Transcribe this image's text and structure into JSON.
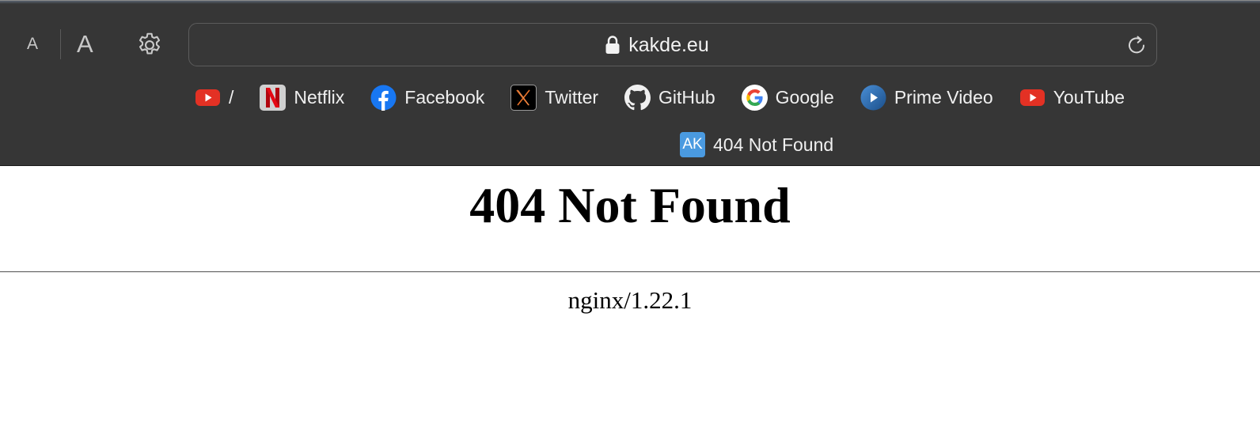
{
  "toolbar": {
    "text_smaller_label": "A",
    "text_larger_label": "A",
    "address": {
      "url": "kakde.eu"
    }
  },
  "favorites": [
    {
      "label": "/",
      "icon": "youtube-icon"
    },
    {
      "label": "Netflix",
      "icon": "netflix-icon"
    },
    {
      "label": "Facebook",
      "icon": "facebook-icon"
    },
    {
      "label": "Twitter",
      "icon": "x-twitter-icon"
    },
    {
      "label": "GitHub",
      "icon": "github-icon"
    },
    {
      "label": "Google",
      "icon": "google-icon"
    },
    {
      "label": "Prime Video",
      "icon": "prime-video-icon"
    },
    {
      "label": "YouTube",
      "icon": "youtube-icon"
    },
    {
      "label": "404 Not Found",
      "icon": "ak-badge-icon",
      "badge_text": "AK"
    }
  ],
  "page": {
    "heading": "404 Not Found",
    "server_line": "nginx/1.22.1"
  },
  "colors": {
    "toolbar_bg": "#363636",
    "youtube_red": "#e33124",
    "netflix_red": "#d81f26",
    "facebook_blue": "#1877f2",
    "ak_badge_blue": "#4a9ae0",
    "prime_blue": "#2a6fb3"
  }
}
